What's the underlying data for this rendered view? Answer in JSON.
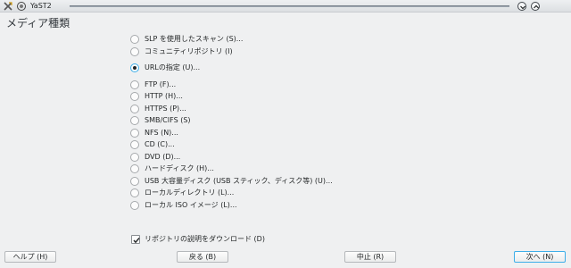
{
  "window": {
    "title": "YaST2"
  },
  "heading": "メディア種類",
  "options": [
    {
      "label": "SLP を使用したスキャン (S)...",
      "checked": false
    },
    {
      "label": "コミュニティリポジトリ (I)",
      "checked": false
    },
    {
      "label": "URLの指定 (U)...",
      "checked": true
    },
    {
      "label": "FTP (F)...",
      "checked": false
    },
    {
      "label": "HTTP (H)...",
      "checked": false
    },
    {
      "label": "HTTPS (P)...",
      "checked": false
    },
    {
      "label": "SMB/CIFS (S)",
      "checked": false
    },
    {
      "label": "NFS (N)...",
      "checked": false
    },
    {
      "label": "CD (C)...",
      "checked": false
    },
    {
      "label": "DVD (D)...",
      "checked": false
    },
    {
      "label": "ハードディスク (H)...",
      "checked": false
    },
    {
      "label": "USB 大容量ディスク (USB スティック、ディスク等) (U)...",
      "checked": false
    },
    {
      "label": "ローカルディレクトリ (L)...",
      "checked": false
    },
    {
      "label": "ローカル ISO イメージ (L)...",
      "checked": false
    }
  ],
  "download_checkbox": {
    "label": "リポジトリの説明をダウンロード (D)",
    "checked": true
  },
  "buttons": {
    "help": "ヘルプ (H)",
    "back": "戻る (B)",
    "abort": "中止 (R)",
    "next": "次へ (N)"
  },
  "icons": {
    "app": "yast-logo-icon",
    "window_menu": "window-menu-icon",
    "minimize": "minimize-icon",
    "maximize": "maximize-icon"
  }
}
